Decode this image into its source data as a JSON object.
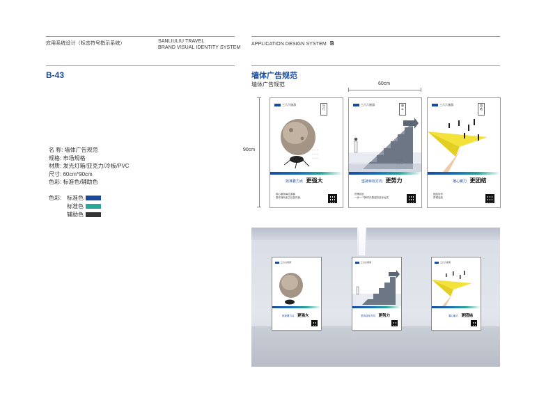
{
  "header": {
    "left_title": "应用系统设计（标志符号指示系统）",
    "brand_line1": "SANLIULIU TRAVEL",
    "brand_line2": "BRAND VISUAL IDENTITY SYSTEM",
    "right_title": "APPLICATION DESIGN SYSTEM",
    "right_letter": "B"
  },
  "page": {
    "code": "B-43",
    "title": "墙体广告规范",
    "subtitle": "墙体广告规范"
  },
  "specs": [
    "名 称: 墙体广告规范",
    "规格: 市场规格",
    "材质: 发光灯箱/亚克力/冷板/PVC",
    "尺寸: 60cm*90cm",
    "色彩: 标准色/辅助色"
  ],
  "colors": {
    "label": "色彩:",
    "items": [
      {
        "name": "标准色",
        "hex": "#1a4a9c"
      },
      {
        "name": "标准色",
        "hex": "#2aa69a"
      },
      {
        "name": "辅助色",
        "hex": "#333333"
      }
    ]
  },
  "dimensions": {
    "width": "60cm",
    "height": "90cm"
  },
  "posters": [
    {
      "brand": "三六六旅游",
      "vertical": "乐 行",
      "slogan_small": "找准着力点",
      "slogan_big": "更强大",
      "foot1": "用心服务每位游客",
      "foot2": "愿你我所到之处皆风景",
      "image": "rock-beetle"
    },
    {
      "brand": "三六六旅游",
      "vertical": "奋 斗",
      "slogan_small": "坚持目标方向",
      "slogan_big": "更努力",
      "foot1": "拼搏成长",
      "foot2": "一步一个脚印向更高的目标出发",
      "image": "stairs"
    },
    {
      "brand": "三六六旅游",
      "vertical": "团 结",
      "slogan_small": "凝心聚力",
      "slogan_big": "更团结",
      "foot1": "团结协作",
      "foot2": "梦想启航",
      "image": "paper-plane"
    }
  ]
}
